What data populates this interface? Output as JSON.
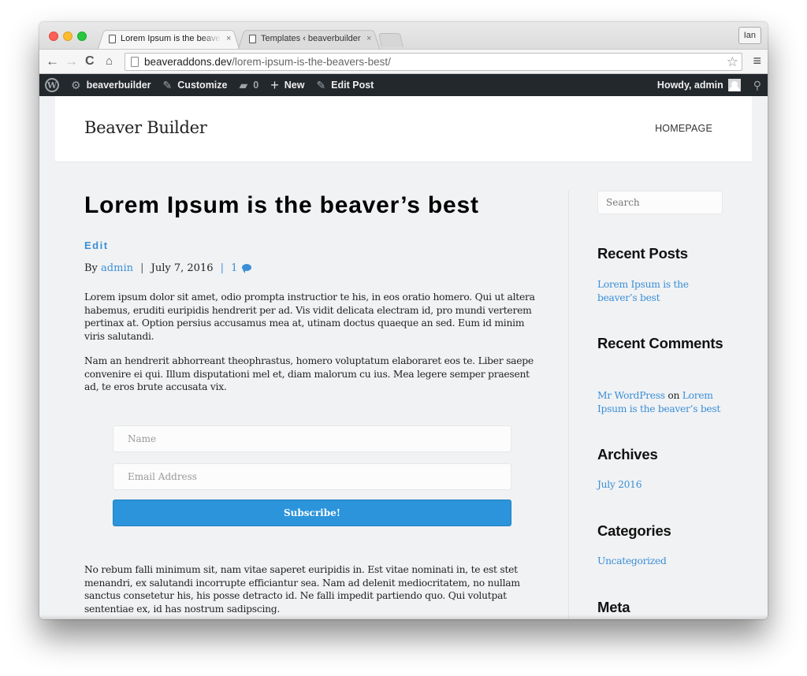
{
  "browser": {
    "tabs": [
      {
        "title": "Lorem Ipsum is the beaver's best",
        "active": true,
        "close": "×"
      },
      {
        "title": "Templates ‹ beaverbuilder",
        "active": false,
        "close": "×"
      }
    ],
    "profile_name": "Ian",
    "url_host": "beaveraddons.dev",
    "url_path": "/lorem-ipsum-is-the-beavers-best/",
    "icons": {
      "back": "←",
      "forward": "→",
      "reload": "C",
      "home": "⌂",
      "star": "☆",
      "menu": "≡"
    }
  },
  "adminbar": {
    "wp_logo": "W",
    "site_name": "beaverbuilder",
    "customize": "Customize",
    "comments_count": "0",
    "new": "New",
    "edit_post": "Edit Post",
    "howdy": "Howdy, admin",
    "icons": {
      "site": "⚙",
      "customize": "✎",
      "comments": "▰",
      "new": "+",
      "edit": "✎",
      "search": "⚲"
    }
  },
  "site": {
    "title": "Beaver Builder",
    "nav": [
      "HOMEPAGE"
    ]
  },
  "post": {
    "title": "Lorem Ipsum is the beaver’s best",
    "edit_label": "Edit",
    "meta": {
      "by": "By",
      "author": "admin",
      "date": "July 7, 2016",
      "sep": "|",
      "comments": "1"
    },
    "paragraphs": [
      "Lorem ipsum dolor sit amet, odio prompta instructior te his, in eos oratio homero. Qui ut altera habemus, eruditi euripidis hendrerit per ad. Vis vidit delicata electram id, pro mundi verterem pertinax at. Option persius accusamus mea at, utinam doctus quaeque an sed. Eum id minim viris salutandi.",
      "Nam an hendrerit abhorreant theophrastus, homero voluptatum elaboraret eos te. Liber saepe convenire ei qui. Illum disputationi mel et, diam malorum cu ius. Mea legere semper praesent ad, te eros brute accusata vix.",
      "No rebum falli minimum sit, nam vitae saperet euripidis in. Est vitae nominati in, te est stet menandri, ex salutandi incorrupte efficiantur sea. Nam ad delenit mediocritatem, no nullam sanctus consetetur his, his posse detracto id. Ne falli impedit partiendo quo. Qui volutpat sententiae ex, id has nostrum sadipscing."
    ],
    "form": {
      "name_placeholder": "Name",
      "email_placeholder": "Email Address",
      "submit_label": "Subscribe!"
    }
  },
  "sidebar": {
    "search_placeholder": "Search",
    "recent_posts": {
      "title": "Recent Posts",
      "items": [
        "Lorem Ipsum is the beaver’s best"
      ]
    },
    "recent_comments": {
      "title": "Recent Comments",
      "items": [
        {
          "author": "Mr WordPress",
          "on": "on",
          "post": "Lorem Ipsum is the beaver’s best"
        }
      ]
    },
    "archives": {
      "title": "Archives",
      "items": [
        "July 2016"
      ]
    },
    "categories": {
      "title": "Categories",
      "items": [
        "Uncategorized"
      ]
    },
    "meta": {
      "title": "Meta"
    }
  },
  "colors": {
    "link": "#3a8fd6",
    "button": "#2b94db",
    "adminbar": "#23282d",
    "page_bg": "#f1f2f4"
  }
}
